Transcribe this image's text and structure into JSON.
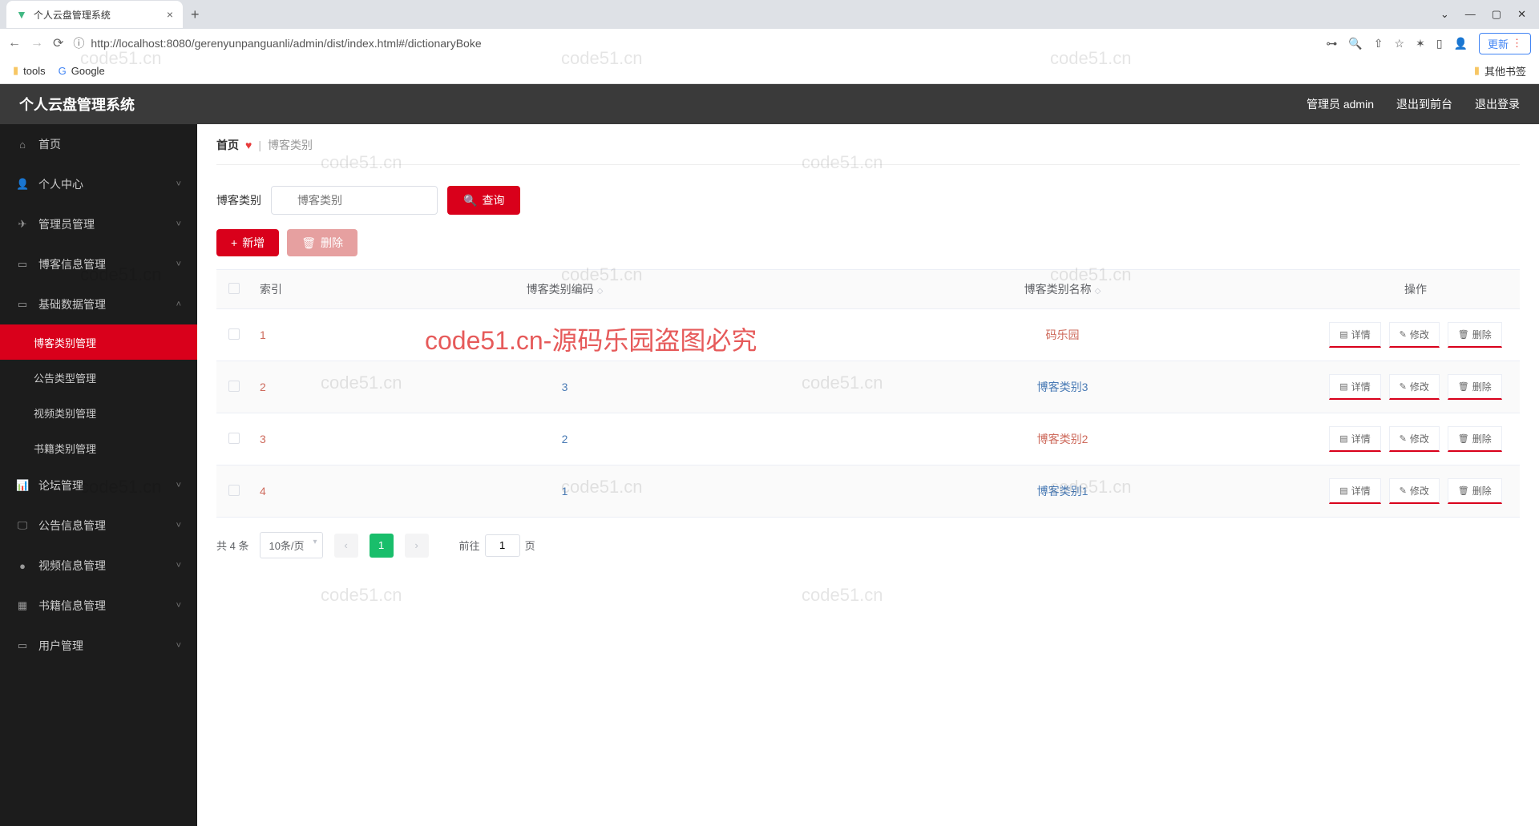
{
  "browser": {
    "tab_title": "个人云盘管理系统",
    "url": "http://localhost:8080/gerenyunpanguanli/admin/dist/index.html#/dictionaryBoke",
    "update_label": "更新",
    "bookmarks": {
      "tools": "tools",
      "google": "Google",
      "other": "其他书签"
    }
  },
  "header": {
    "title": "个人云盘管理系统",
    "user": "管理员 admin",
    "logout_front": "退出到前台",
    "logout": "退出登录"
  },
  "sidebar": {
    "home": "首页",
    "items": [
      {
        "icon": "👤",
        "label": "个人中心",
        "expandable": true
      },
      {
        "icon": "✈",
        "label": "管理员管理",
        "expandable": true
      },
      {
        "icon": "▭",
        "label": "博客信息管理",
        "expandable": true
      },
      {
        "icon": "▭",
        "label": "基础数据管理",
        "expandable": true,
        "expanded": true,
        "children": [
          {
            "label": "博客类别管理",
            "active": true
          },
          {
            "label": "公告类型管理"
          },
          {
            "label": "视频类别管理"
          },
          {
            "label": "书籍类别管理"
          }
        ]
      },
      {
        "icon": "📊",
        "label": "论坛管理",
        "expandable": true
      },
      {
        "icon": "🖵",
        "label": "公告信息管理",
        "expandable": true
      },
      {
        "icon": "●",
        "label": "视频信息管理",
        "expandable": true
      },
      {
        "icon": "▦",
        "label": "书籍信息管理",
        "expandable": true
      },
      {
        "icon": "▭",
        "label": "用户管理",
        "expandable": true
      }
    ]
  },
  "breadcrumb": {
    "home": "首页",
    "current": "博客类别"
  },
  "search": {
    "label": "博客类别",
    "placeholder": "博客类别",
    "button": "查询"
  },
  "actions": {
    "add": "新增",
    "delete": "删除"
  },
  "table": {
    "columns": {
      "index": "索引",
      "code": "博客类别编码",
      "name": "博客类别名称",
      "op": "操作"
    },
    "ops": {
      "detail": "详情",
      "edit": "修改",
      "delete": "删除"
    },
    "rows": [
      {
        "index": "1",
        "code": "",
        "name": "码乐园",
        "name_color": "red"
      },
      {
        "index": "2",
        "code": "3",
        "name": "博客类别3",
        "name_color": "blue"
      },
      {
        "index": "3",
        "code": "2",
        "name": "博客类别2",
        "name_color": "red"
      },
      {
        "index": "4",
        "code": "1",
        "name": "博客类别1",
        "name_color": "blue"
      }
    ]
  },
  "pagination": {
    "total": "共 4 条",
    "page_size": "10条/页",
    "current": "1",
    "goto_prefix": "前往",
    "goto_value": "1",
    "goto_suffix": "页"
  },
  "watermarks": {
    "text": "code51.cn",
    "banner": "code51.cn-源码乐园盗图必究"
  }
}
